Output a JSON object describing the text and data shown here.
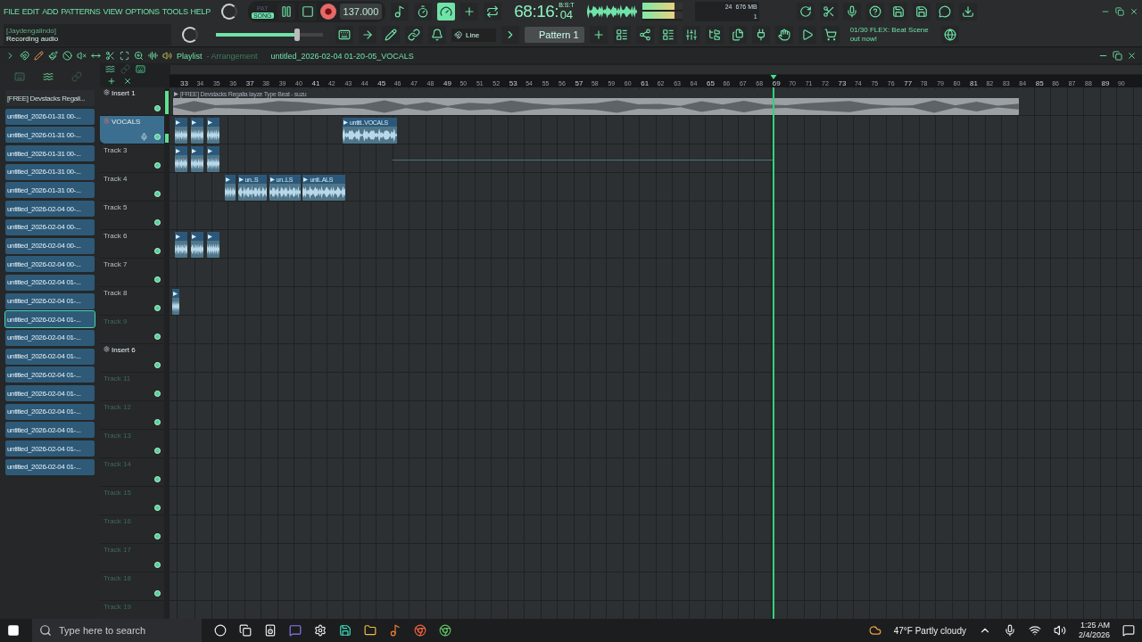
{
  "menu": [
    "FILE",
    "EDIT",
    "ADD",
    "PATTERNS",
    "VIEW",
    "OPTIONS",
    "TOOLS",
    "HELP"
  ],
  "hint": {
    "user": "[Jaydengalindo]",
    "message": "Recording audio"
  },
  "modes": [
    {
      "label": "PAT",
      "selected": false
    },
    {
      "label": "SONG",
      "selected": true
    }
  ],
  "recording": true,
  "tempo": "137.000",
  "time": {
    "main": "68:16:",
    "small": "04",
    "format": "B:S:T"
  },
  "peak_meter": {
    "level": 0.8
  },
  "cpu": {
    "voices": "24",
    "memory": "676 MB",
    "count": "1"
  },
  "master_volume": {
    "level": 0.76
  },
  "snap": "Line",
  "pattern": "Pattern 1",
  "news": {
    "count": "01/30",
    "text": "FLEX: Beat Scene out now!"
  },
  "playlist": {
    "title": "Playlist",
    "subtitle": "- Arrangement",
    "file": "untitled_2026-02-04 01-20-05_VOCALS"
  },
  "browser": [
    {
      "label": "[FREE] Devstacks  Regali...",
      "kind": "folder",
      "selected": false
    },
    {
      "label": "untitled_2026-01-31 00-...",
      "kind": "file",
      "selected": false
    },
    {
      "label": "untitled_2026-01-31 00-...",
      "kind": "file",
      "selected": false
    },
    {
      "label": "untitled_2026-01-31 00-...",
      "kind": "file",
      "selected": false
    },
    {
      "label": "untitled_2026-01-31 00-...",
      "kind": "file",
      "selected": false
    },
    {
      "label": "untitled_2026-01-31 00-...",
      "kind": "file",
      "selected": false
    },
    {
      "label": "untitled_2026-02-04 00-...",
      "kind": "file",
      "selected": false
    },
    {
      "label": "untitled_2026-02-04 00-...",
      "kind": "file",
      "selected": false
    },
    {
      "label": "untitled_2026-02-04 00-...",
      "kind": "file",
      "selected": false
    },
    {
      "label": "untitled_2026-02-04 00-...",
      "kind": "file",
      "selected": false
    },
    {
      "label": "untitled_2026-02-04 01-...",
      "kind": "file",
      "selected": false
    },
    {
      "label": "untitled_2026-02-04 01-...",
      "kind": "file",
      "selected": false
    },
    {
      "label": "untitled_2026-02-04 01-...",
      "kind": "file",
      "selected": true
    },
    {
      "label": "untitled_2026-02-04 01-...",
      "kind": "file",
      "selected": false
    },
    {
      "label": "untitled_2026-02-04 01-...",
      "kind": "file",
      "selected": false
    },
    {
      "label": "untitled_2026-02-04 01-...",
      "kind": "file",
      "selected": false
    },
    {
      "label": "untitled_2026-02-04 01-...",
      "kind": "file",
      "selected": false
    },
    {
      "label": "untitled_2026-02-04 01-...",
      "kind": "file",
      "selected": false
    },
    {
      "label": "untitled_2026-02-04 01-...",
      "kind": "file",
      "selected": false
    },
    {
      "label": "untitled_2026-02-04 01-...",
      "kind": "file",
      "selected": false
    },
    {
      "label": "untitled_2026-02-04 01-...",
      "kind": "file",
      "selected": false
    }
  ],
  "ruler": [
    "33",
    "34",
    "35",
    "36",
    "37",
    "38",
    "39",
    "40",
    "41",
    "42",
    "43",
    "44",
    "45",
    "46",
    "47",
    "48",
    "49",
    "50",
    "51",
    "52",
    "53",
    "54",
    "55",
    "56",
    "57",
    "58",
    "59",
    "60",
    "61",
    "62",
    "63",
    "64",
    "65",
    "66",
    "67",
    "68",
    "69",
    "70",
    "71",
    "72",
    "73",
    "74",
    "75",
    "76",
    "77",
    "78",
    "79",
    "80",
    "81",
    "82",
    "83",
    "84",
    "85",
    "86",
    "87",
    "88",
    "89",
    "90"
  ],
  "tracks": [
    {
      "name": "Insert 1",
      "kind": "insert",
      "active": true,
      "selected": false,
      "clips": [
        {
          "kind": "sample",
          "label": "[FREE] Devstacks  Regalia  Iayze Type Beat - suzu"
        }
      ]
    },
    {
      "name": "VOCALS",
      "kind": "insert",
      "active": true,
      "selected": true,
      "clips": [
        {
          "kind": "recording"
        },
        {
          "kind": "recording"
        },
        {
          "kind": "recording"
        },
        {
          "kind": "recording",
          "label": "untitl..VOCALS"
        }
      ]
    },
    {
      "name": "Track 3",
      "kind": "track",
      "active": true,
      "selected": false,
      "clips": [
        {
          "kind": "recording"
        },
        {
          "kind": "recording"
        },
        {
          "kind": "recording"
        }
      ]
    },
    {
      "name": "Track 4",
      "kind": "track",
      "active": true,
      "selected": false,
      "clips": [
        {
          "kind": "recording"
        },
        {
          "kind": "recording",
          "label": "un..S"
        },
        {
          "kind": "recording",
          "label": "un..LS"
        },
        {
          "kind": "recording",
          "label": "unti..ALS"
        }
      ]
    },
    {
      "name": "Track 5",
      "kind": "track",
      "active": true,
      "selected": false
    },
    {
      "name": "Track 6",
      "kind": "track",
      "active": true,
      "selected": false,
      "clips": [
        {
          "kind": "recording"
        },
        {
          "kind": "recording"
        },
        {
          "kind": "recording"
        }
      ]
    },
    {
      "name": "Track 7",
      "kind": "track",
      "active": true,
      "selected": false
    },
    {
      "name": "Track 8",
      "kind": "track",
      "active": true,
      "selected": false,
      "clips": [
        {
          "kind": "recording"
        }
      ]
    },
    {
      "name": "Track 9",
      "kind": "track",
      "active": false,
      "selected": false
    },
    {
      "name": "Insert 6",
      "kind": "insert",
      "active": true,
      "selected": false
    },
    {
      "name": "Track 11",
      "kind": "track",
      "active": false,
      "selected": false
    },
    {
      "name": "Track 12",
      "kind": "track",
      "active": false,
      "selected": false
    },
    {
      "name": "Track 13",
      "kind": "track",
      "active": false,
      "selected": false
    },
    {
      "name": "Track 14",
      "kind": "track",
      "active": false,
      "selected": false
    },
    {
      "name": "Track 15",
      "kind": "track",
      "active": false,
      "selected": false
    },
    {
      "name": "Track 16",
      "kind": "track",
      "active": false,
      "selected": false
    },
    {
      "name": "Track 17",
      "kind": "track",
      "active": false,
      "selected": false
    },
    {
      "name": "Track 18",
      "kind": "track",
      "active": false,
      "selected": false
    },
    {
      "name": "Track 19",
      "kind": "track",
      "active": false,
      "selected": false
    }
  ],
  "taskbar": {
    "search_placeholder": "Type here to search",
    "weather": "47°F  Partly cloudy",
    "time": "1:25 AM",
    "date": "2/4/2026"
  }
}
